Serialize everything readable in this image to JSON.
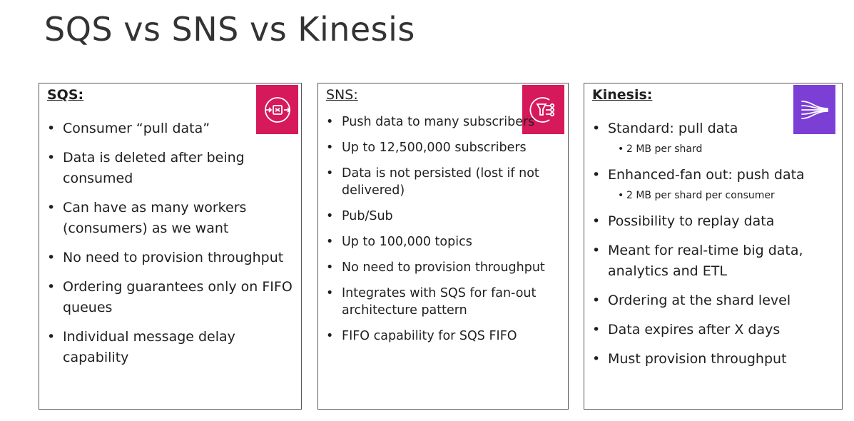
{
  "title": "SQS vs SNS vs Kinesis",
  "colors": {
    "sqs_logo": "#d6195a",
    "sns_logo": "#d6195a",
    "kinesis_logo": "#7c3fd6"
  },
  "sqs": {
    "heading": "SQS:",
    "icon": "sqs-queue-icon",
    "items": [
      "Consumer “pull data”",
      "Data is deleted after being consumed",
      "Can have as many workers (consumers) as we want",
      "No need to provision throughput",
      "Ordering guarantees only on FIFO queues",
      "Individual message delay capability"
    ]
  },
  "sns": {
    "heading": "SNS:",
    "icon": "sns-topic-icon",
    "items": [
      "Push data to many subscribers",
      "Up to 12,500,000 subscribers",
      "Data is not persisted (lost if not delivered)",
      "Pub/Sub",
      "Up to 100,000 topics",
      "No need to provision throughput",
      "Integrates with SQS for fan-out architecture pattern",
      "FIFO capability for SQS FIFO"
    ]
  },
  "kinesis": {
    "heading": "Kinesis:",
    "icon": "kinesis-streams-icon",
    "items": [
      {
        "text": "Standard: pull data",
        "sub": "2 MB per shard"
      },
      {
        "text": "Enhanced-fan out: push data",
        "sub": "2 MB per shard per consumer"
      },
      {
        "text": "Possibility to replay data"
      },
      {
        "text": "Meant for real-time big data, analytics and ETL"
      },
      {
        "text": "Ordering at the shard level"
      },
      {
        "text": "Data expires after X days"
      },
      {
        "text": "Must provision throughput"
      }
    ]
  }
}
